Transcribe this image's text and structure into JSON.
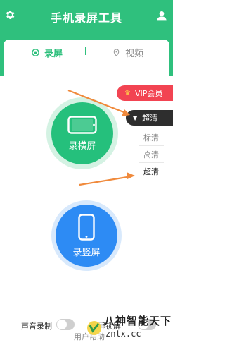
{
  "header": {
    "title": "手机录屏工具",
    "settings_icon": "gear-icon",
    "profile_icon": "user-icon",
    "background": "#2fc07d"
  },
  "tabs": [
    {
      "label": "录屏",
      "icon": "record-dot-icon",
      "active": true
    },
    {
      "label": "视频",
      "icon": "location-pin-icon",
      "active": false
    }
  ],
  "main": {
    "landscape_button": {
      "label": "录横屏",
      "icon": "phone-landscape-icon",
      "color": "#25c07c"
    },
    "portrait_button": {
      "label": "录竖屏",
      "icon": "phone-portrait-icon",
      "color": "#2d8bf4"
    }
  },
  "vip": {
    "label": "VIP会员",
    "icon": "crown-icon",
    "color": "#f24452"
  },
  "quality": {
    "selected": "超清",
    "options": [
      "标清",
      "高清",
      "超清"
    ],
    "highlight_index": 2
  },
  "footer": {
    "help_link": "用户帮助",
    "sound_label": "声音录制",
    "screen_label": "录屏锁屏",
    "sound_toggle_on": false,
    "screen_toggle_on": false
  },
  "watermark": {
    "line1": "八神智能天下",
    "line2": "zntx.cc"
  },
  "annotation_color": "#f08a3c"
}
